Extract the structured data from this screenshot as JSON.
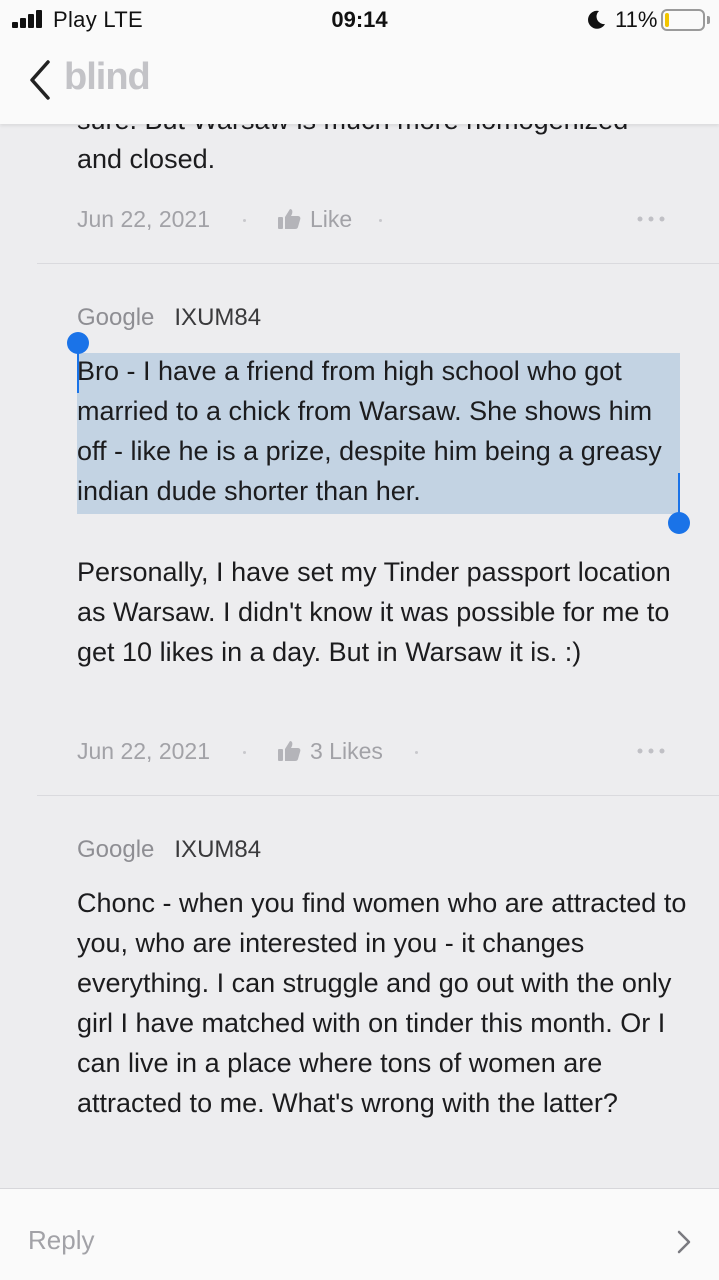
{
  "status_bar": {
    "carrier": "Play  LTE",
    "time": "09:14",
    "battery_percent": "11%",
    "battery_level": 0.11,
    "icons": [
      "signal-icon",
      "moon-icon",
      "battery-icon"
    ]
  },
  "nav": {
    "logo": "blind",
    "back_icon": "chevron-left-icon"
  },
  "comments": [
    {
      "partial_line": "sure. But Warsaw is much more homogenized",
      "body": "and closed.",
      "date": "Jun 22, 2021",
      "likes": "Like"
    },
    {
      "company": "Google",
      "nickname": "IXUM84",
      "selected_text": "Bro - I have a friend from high school who got married to a chick from Warsaw. She shows him off - like he is a prize, despite him being a greasy indian dude shorter than her.",
      "body": "Personally, I have set my Tinder passport location as Warsaw. I didn't know it was possible for me to get 10 likes in a day. But in Warsaw it is. :)",
      "date": "Jun 22, 2021",
      "likes": "3 Likes"
    },
    {
      "company": "Google",
      "nickname": "IXUM84",
      "body": "Chonc - when you find women who are attracted to you, who are interested in you - it changes everything. I can struggle and go out with the only girl I have matched with on tinder this month. Or I can live in a place where tons of women are attracted to me. What's wrong with the latter?"
    }
  ],
  "reply_bar": {
    "placeholder": "Reply",
    "send_icon": "chevron-right-icon"
  },
  "colors": {
    "background": "#ededef",
    "selection": "#c3d3e3",
    "selection_handle": "#1a73e8",
    "battery": "#f2c500"
  }
}
